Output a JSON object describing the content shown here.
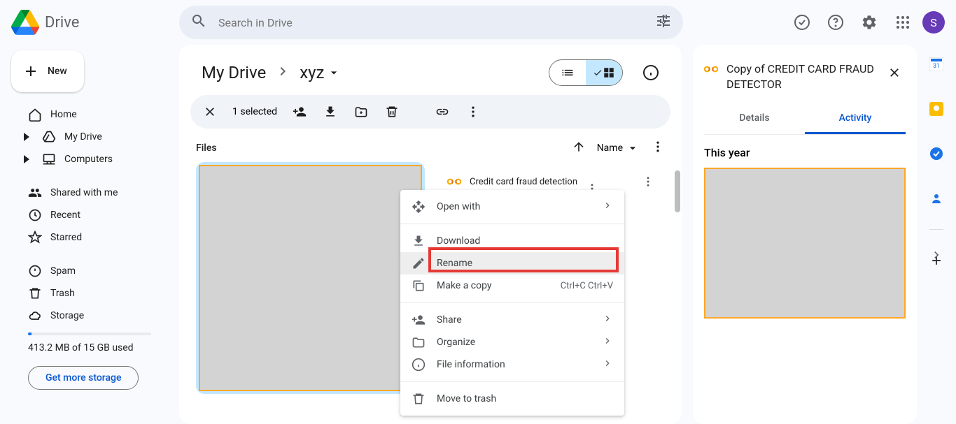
{
  "app": {
    "name": "Drive"
  },
  "search": {
    "placeholder": "Search in Drive"
  },
  "avatar": {
    "letter": "S"
  },
  "sidebar": {
    "new_label": "New",
    "items": [
      {
        "label": "Home"
      },
      {
        "label": "My Drive"
      },
      {
        "label": "Computers"
      },
      {
        "label": "Shared with me"
      },
      {
        "label": "Recent"
      },
      {
        "label": "Starred"
      },
      {
        "label": "Spam"
      },
      {
        "label": "Trash"
      },
      {
        "label": "Storage"
      }
    ],
    "storage_text": "413.2 MB of 15 GB used",
    "storage_btn": "Get more storage"
  },
  "breadcrumb": {
    "root": "My Drive",
    "current": "xyz"
  },
  "selection": {
    "count_text": "1 selected"
  },
  "files_section": {
    "label": "Files",
    "sort_label": "Name"
  },
  "files": [
    {
      "name": ""
    },
    {
      "name": "Credit card fraud detection"
    }
  ],
  "context_menu": {
    "open_with": "Open with",
    "download": "Download",
    "rename": "Rename",
    "make_copy": "Make a copy",
    "make_copy_shortcut": "Ctrl+C Ctrl+V",
    "share": "Share",
    "organize": "Organize",
    "file_info": "File information",
    "move_trash": "Move to trash"
  },
  "details": {
    "title": "Copy of CREDIT CARD FRAUD DETECTOR",
    "tab_details": "Details",
    "tab_activity": "Activity",
    "activity_label": "This year"
  }
}
